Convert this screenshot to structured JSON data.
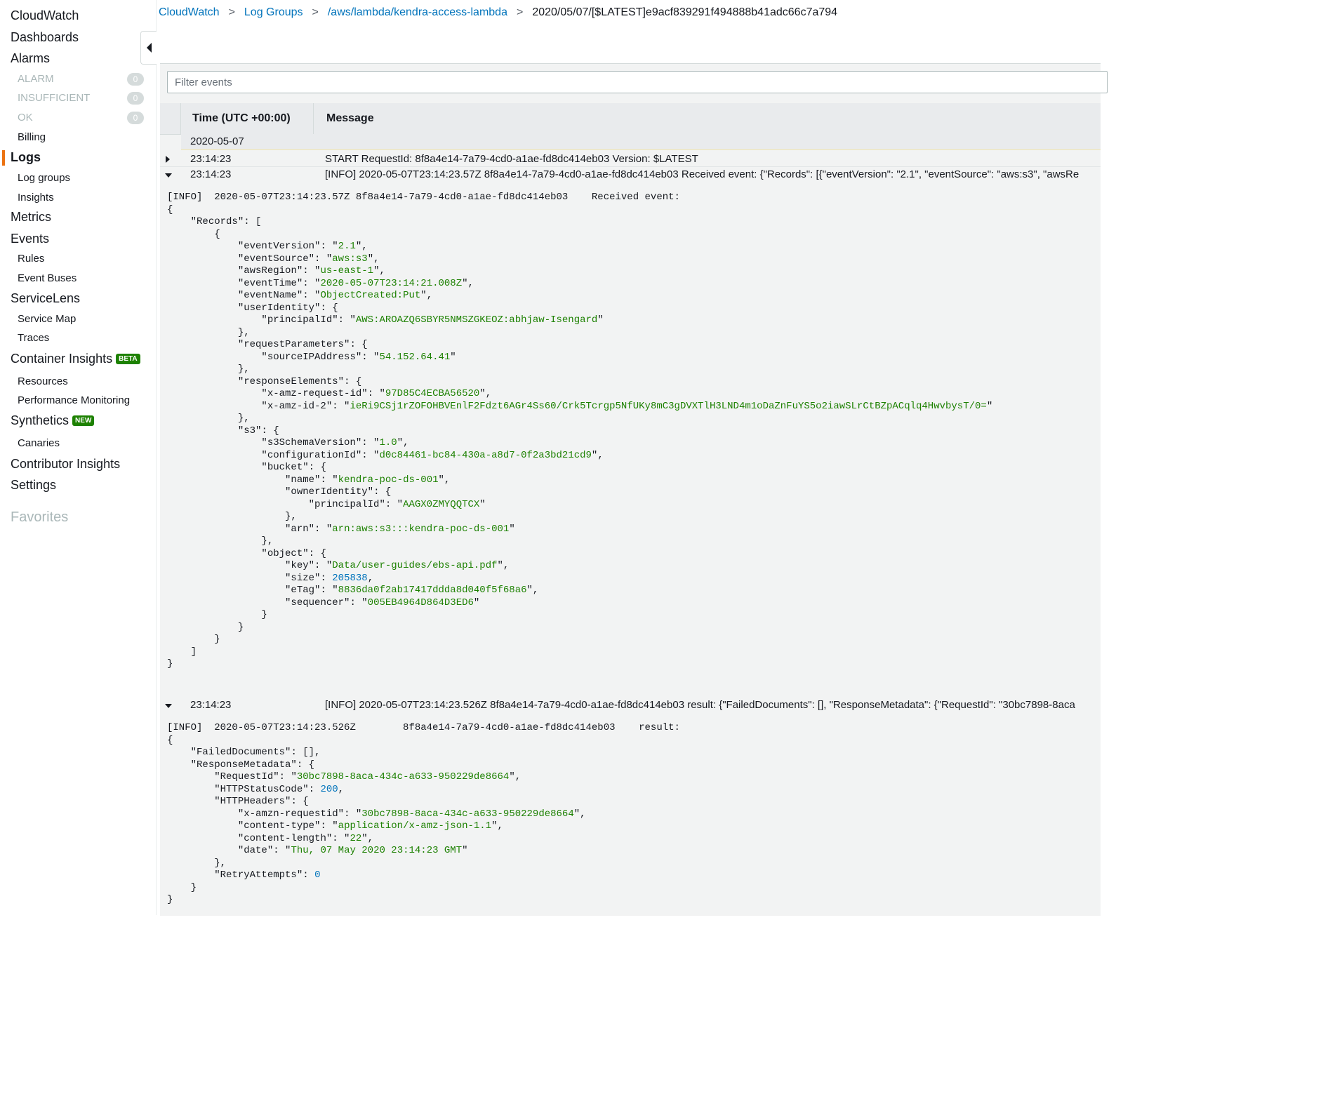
{
  "sidebar": {
    "cloudwatch": "CloudWatch",
    "dashboards": "Dashboards",
    "alarms": "Alarms",
    "alarm_states": [
      {
        "label": "ALARM",
        "count": "0"
      },
      {
        "label": "INSUFFICIENT",
        "count": "0"
      },
      {
        "label": "OK",
        "count": "0"
      }
    ],
    "billing": "Billing",
    "logs": "Logs",
    "log_groups": "Log groups",
    "insights": "Insights",
    "metrics": "Metrics",
    "events": "Events",
    "rules": "Rules",
    "event_buses": "Event Buses",
    "servicelens": "ServiceLens",
    "service_map": "Service Map",
    "traces": "Traces",
    "container_insights": "Container Insights",
    "beta_badge": "BETA",
    "resources": "Resources",
    "performance_monitoring": "Performance Monitoring",
    "synthetics": "Synthetics",
    "new_badge": "NEW",
    "canaries": "Canaries",
    "contributor_insights": "Contributor Insights",
    "settings": "Settings",
    "favorites": "Favorites",
    "active_color": "#ec7211"
  },
  "breadcrumb": {
    "items": [
      "CloudWatch",
      "Log Groups",
      "/aws/lambda/kendra-access-lambda"
    ],
    "current": "2020/05/07/[$LATEST]e9acf839291f494888b41adc66c7a794",
    "separator": ">"
  },
  "filter": {
    "placeholder": "Filter events",
    "value": ""
  },
  "table": {
    "col_time": "Time (UTC +00:00)",
    "col_message": "Message",
    "date": "2020-05-07",
    "rows": [
      {
        "time": "23:14:23",
        "message": "START RequestId: 8f8a4e14-7a79-4cd0-a1ae-fd8dc414eb03 Version: $LATEST",
        "expanded": false
      },
      {
        "time": "23:14:23",
        "message": "[INFO] 2020-05-07T23:14:23.57Z 8f8a4e14-7a79-4cd0-a1ae-fd8dc414eb03 Received event: {\"Records\": [{\"eventVersion\": \"2.1\", \"eventSource\": \"aws:s3\", \"awsRe",
        "expanded": true
      },
      {
        "time": "23:14:23",
        "message": "[INFO] 2020-05-07T23:14:23.526Z 8f8a4e14-7a79-4cd0-a1ae-fd8dc414eb03 result: {\"FailedDocuments\": [], \"ResponseMetadata\": {\"RequestId\": \"30bc7898-8aca",
        "expanded": true
      }
    ]
  },
  "event1": {
    "header": "[INFO]  2020-05-07T23:14:23.57Z 8f8a4e14-7a79-4cd0-a1ae-fd8dc414eb03    Received event:",
    "eventVersion": "2.1",
    "eventSource": "aws:s3",
    "awsRegion": "us-east-1",
    "eventTime": "2020-05-07T23:14:21.008Z",
    "eventName": "ObjectCreated:Put",
    "userPrincipalId": "AWS:AROAZQ6SBYR5NMSZGKEOZ:abhjaw-Isengard",
    "sourceIPAddress": "54.152.64.41",
    "xAmzRequestId": "97D85C4ECBA56520",
    "xAmzId2": "ieRi9CSj1rZOFOHBVEnlF2Fdzt6AGr4Ss60/Crk5Tcrgp5NfUKy8mC3gDVXTlH3LND4m1oDaZnFuYS5o2iawSLrCtBZpACqlq4HwvbysT/0=",
    "s3SchemaVersion": "1.0",
    "configurationId": "d0c84461-bc84-430a-a8d7-0f2a3bd21cd9",
    "bucketName": "kendra-poc-ds-001",
    "ownerPrincipalId": "AAGX0ZMYQQTCX",
    "bucketArn": "arn:aws:s3:::kendra-poc-ds-001",
    "objectKey": "Data/user-guides/ebs-api.pdf",
    "objectSize": "205838",
    "eTag": "8836da0f2ab17417ddda8d040f5f68a6",
    "sequencer": "005EB4964D864D3ED6"
  },
  "event2": {
    "header": "[INFO]  2020-05-07T23:14:23.526Z        8f8a4e14-7a79-4cd0-a1ae-fd8dc414eb03    result:",
    "requestId": "30bc7898-8aca-434c-a633-950229de8664",
    "httpStatusCode": "200",
    "xAmznRequestId": "30bc7898-8aca-434c-a633-950229de8664",
    "contentType": "application/x-amz-json-1.1",
    "contentLength": "22",
    "date": "Thu, 07 May 2020 23:14:23 GMT",
    "retryAttempts": "0"
  }
}
